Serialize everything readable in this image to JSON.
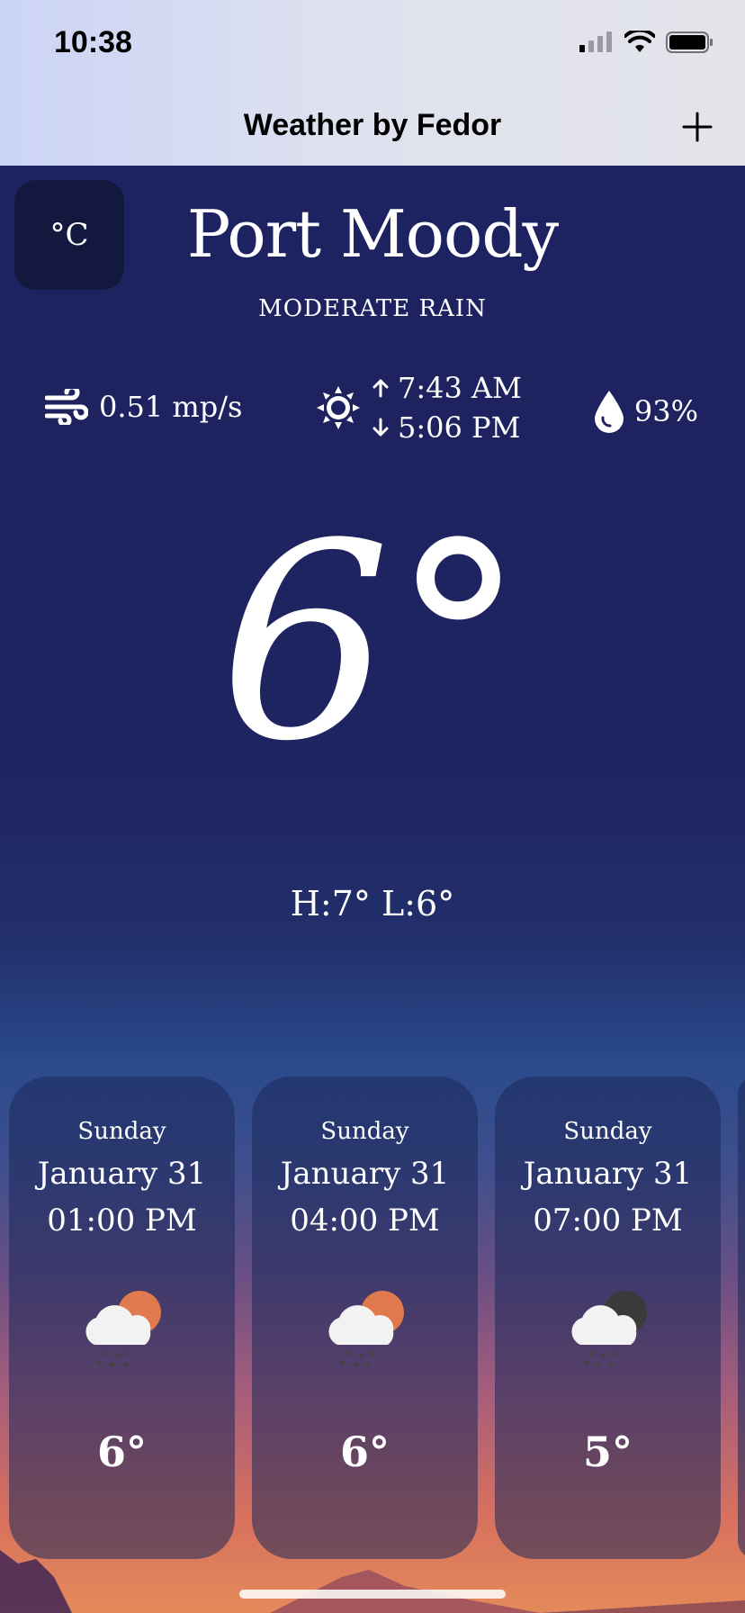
{
  "status_bar": {
    "time": "10:38"
  },
  "nav": {
    "title": "Weather by Fedor",
    "add_icon": "plus-icon"
  },
  "unit_toggle": {
    "label": "°C"
  },
  "current": {
    "city": "Port Moody",
    "condition": "MODERATE RAIN",
    "wind": "0.51 mp/s",
    "sunrise": "7:43 AM",
    "sunset": "5:06 PM",
    "humidity": "93%",
    "temperature": "6°",
    "hi_lo": "H:7° L:6°"
  },
  "forecast": [
    {
      "day": "Sunday",
      "date": "January 31",
      "time": "01:00 PM",
      "temp": "6°",
      "icon": "rain-cloud-sun-icon"
    },
    {
      "day": "Sunday",
      "date": "January 31",
      "time": "04:00 PM",
      "temp": "6°",
      "icon": "rain-cloud-sun-icon"
    },
    {
      "day": "Sunday",
      "date": "January 31",
      "time": "07:00 PM",
      "temp": "5°",
      "icon": "rain-cloud-moon-icon"
    }
  ],
  "colors": {
    "accent_sun": "#e07a4e",
    "dark_moon": "#3a3a3a",
    "card_bg": "#1c285a"
  }
}
